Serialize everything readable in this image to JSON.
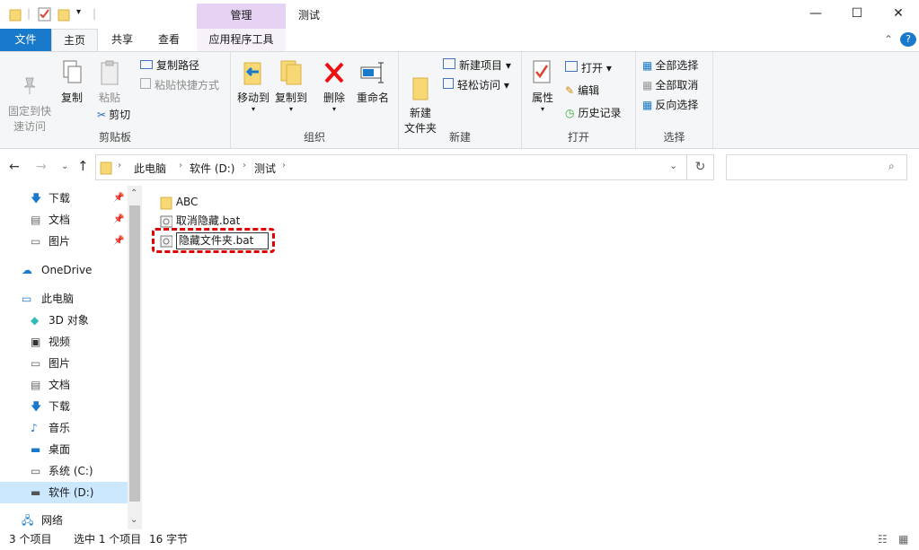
{
  "title": {
    "context_tab": "管理",
    "window": "测试"
  },
  "tabs": {
    "file": "文件",
    "home": "主页",
    "share": "共享",
    "view": "查看",
    "app_tools": "应用程序工具"
  },
  "ribbon": {
    "clipboard": {
      "pin": "固定到快\n速访问",
      "copy": "复制",
      "paste": "粘贴",
      "copy_path": "复制路径",
      "paste_shortcut": "粘贴快捷方式",
      "cut": "剪切",
      "label": "剪贴板"
    },
    "organize": {
      "move_to": "移动到",
      "copy_to": "复制到",
      "delete": "删除",
      "rename": "重命名",
      "label": "组织"
    },
    "new": {
      "new_folder": "新建\n文件夹",
      "new_item": "新建项目",
      "easy_access": "轻松访问",
      "label": "新建"
    },
    "open": {
      "properties": "属性",
      "open": "打开",
      "edit": "编辑",
      "history": "历史记录",
      "label": "打开"
    },
    "select": {
      "select_all": "全部选择",
      "select_none": "全部取消",
      "invert": "反向选择",
      "label": "选择"
    }
  },
  "breadcrumb": [
    "此电脑",
    "软件 (D:)",
    "测试"
  ],
  "nav": {
    "quick": [
      {
        "label": "下载"
      },
      {
        "label": "文档"
      },
      {
        "label": "图片"
      }
    ],
    "onedrive": "OneDrive",
    "thispc": "此电脑",
    "pc_items": [
      {
        "label": "3D 对象"
      },
      {
        "label": "视频"
      },
      {
        "label": "图片"
      },
      {
        "label": "文档"
      },
      {
        "label": "下载"
      },
      {
        "label": "音乐"
      },
      {
        "label": "桌面"
      },
      {
        "label": "系统 (C:)"
      },
      {
        "label": "软件 (D:)"
      }
    ],
    "network": "网络"
  },
  "files": [
    {
      "name": "ABC",
      "type": "folder"
    },
    {
      "name": "取消隐藏.bat",
      "type": "bat"
    },
    {
      "name": "隐藏文件夹.bat",
      "type": "bat",
      "renaming": true
    }
  ],
  "status": {
    "count": "3 个项目",
    "selected": "选中 1 个项目",
    "size": "16 字节"
  },
  "colors": {
    "file_tab": "#1979ca",
    "context_tab": "#e6d3f3",
    "highlight": "#e00000",
    "selected_nav": "#cce8ff"
  }
}
